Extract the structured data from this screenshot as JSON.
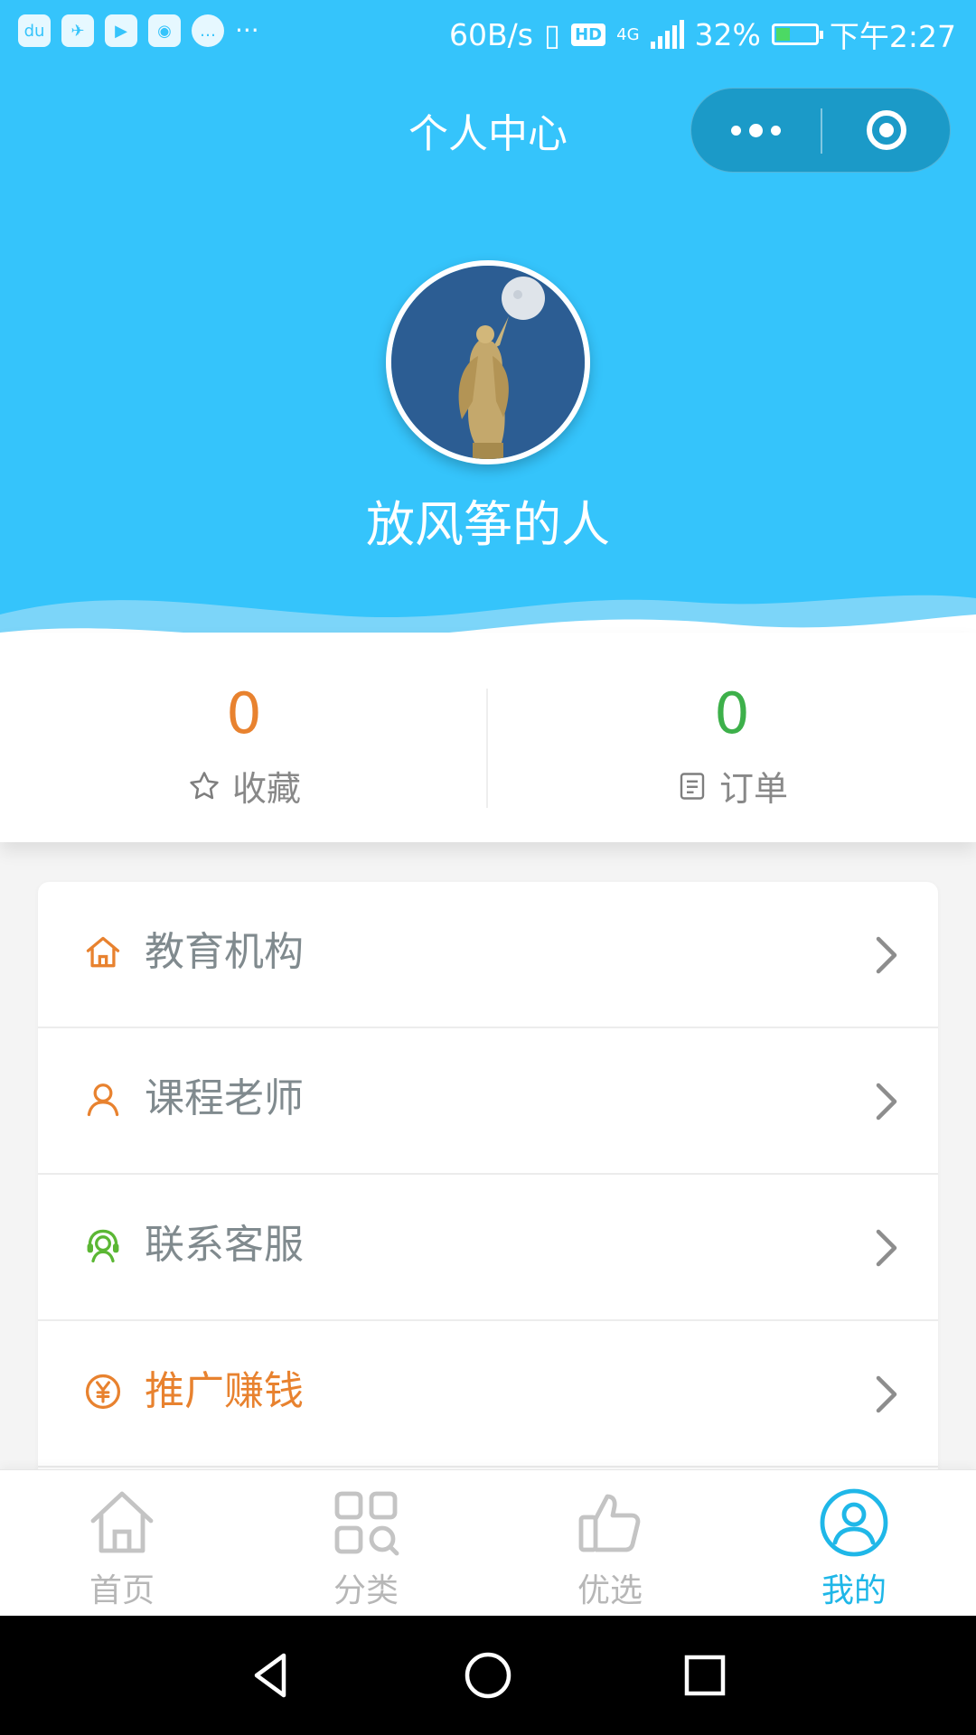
{
  "colors": {
    "header_blue": "#35c4fb",
    "capsule": "#1b9ac8",
    "orange": "#e8822f",
    "green": "#3db04a",
    "active_tab": "#1fb7e8"
  },
  "status_bar": {
    "notification_icons": [
      "baidu-icon",
      "bird-icon",
      "video-icon",
      "camera-icon",
      "chat-icon"
    ],
    "more": "···",
    "speed": "60B/s",
    "hd": "HD",
    "network": "4G",
    "battery": "32%",
    "battery_level": 0.32,
    "time": "下午2:27"
  },
  "header": {
    "title": "个人中心",
    "username": "放风筝的人",
    "avatar_icon": "angel-statue-avatar"
  },
  "stats": [
    {
      "value": "0",
      "label": "收藏",
      "icon": "star-icon"
    },
    {
      "value": "0",
      "label": "订单",
      "icon": "order-list-icon"
    }
  ],
  "menu": [
    {
      "label": "教育机构",
      "icon": "home-icon"
    },
    {
      "label": "课程老师",
      "icon": "person-icon"
    },
    {
      "label": "联系客服",
      "icon": "customer-service-icon"
    },
    {
      "label": "推广赚钱",
      "icon": "yen-coin-icon"
    }
  ],
  "tabbar": [
    {
      "label": "首页",
      "icon": "home-icon"
    },
    {
      "label": "分类",
      "icon": "category-grid-icon"
    },
    {
      "label": "优选",
      "icon": "thumbs-up-icon"
    },
    {
      "label": "我的",
      "icon": "user-circle-icon",
      "active": true
    }
  ],
  "android_nav": [
    "back-icon",
    "home-circle-icon",
    "recent-apps-icon"
  ]
}
